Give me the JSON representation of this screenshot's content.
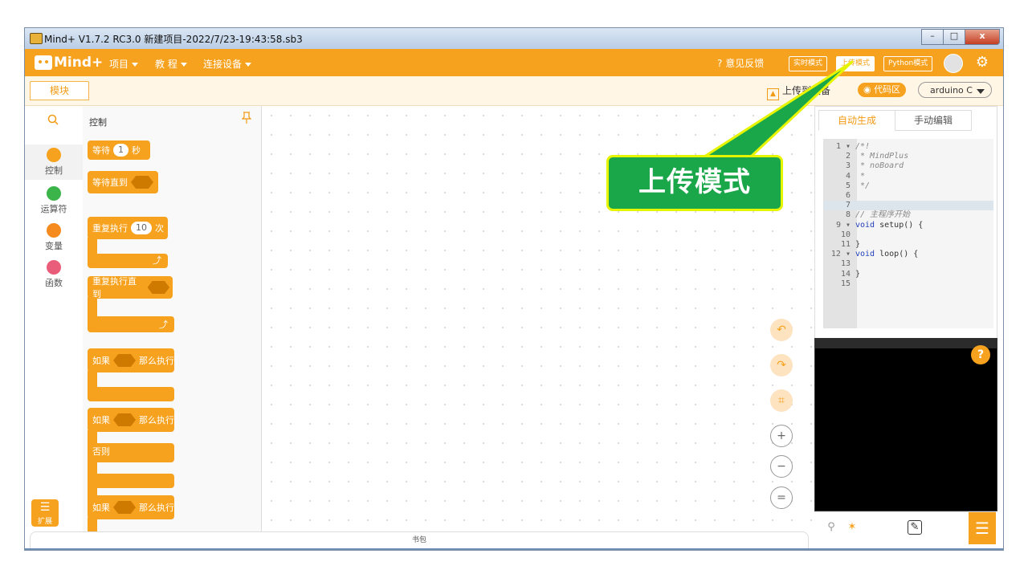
{
  "window": {
    "title": "Mind+ V1.7.2 RC3.0  新建项目-2022/7/23-19:43:58.sb3"
  },
  "menubar": {
    "logo": "Mind+",
    "items": [
      "项目",
      "教 程",
      "连接设备"
    ],
    "feedback": "意见反馈",
    "modes": [
      "实时模式",
      "上传模式",
      "Python模式"
    ],
    "active_mode": "上传模式"
  },
  "toolbar": {
    "blocks_tab": "模块",
    "upload_to_device": "上传到设备",
    "code_area": "代码区",
    "board": "arduino C"
  },
  "categories": [
    {
      "label": "控制",
      "color": "#f7a21e"
    },
    {
      "label": "运算符",
      "color": "#3bb54a"
    },
    {
      "label": "变量",
      "color": "#f58a1f"
    },
    {
      "label": "函数",
      "color": "#ea5d7a"
    }
  ],
  "extensions_label": "扩展",
  "palette": {
    "title": "控制",
    "wait": {
      "label": "等待",
      "value": "1",
      "unit": "秒"
    },
    "wait_until": "等待直到",
    "repeat": {
      "label": "重复执行",
      "value": "10",
      "unit": "次"
    },
    "repeat_until": "重复执行直到",
    "if_then": {
      "if": "如果",
      "then": "那么执行"
    },
    "if_else": {
      "if": "如果",
      "then": "那么执行",
      "else": "否则"
    },
    "if_then2": {
      "if": "如果",
      "then": "那么执行"
    }
  },
  "callout": "上传模式",
  "code_tabs": [
    "自动生成",
    "手动编辑"
  ],
  "code_lines": [
    {
      "n": "1 ▾",
      "t": "/*!",
      "c": "cmt"
    },
    {
      "n": "2",
      "t": " * MindPlus",
      "c": "cmt"
    },
    {
      "n": "3",
      "t": " * noBoard",
      "c": "cmt"
    },
    {
      "n": "4",
      "t": " *",
      "c": "cmt"
    },
    {
      "n": "5",
      "t": " */",
      "c": "cmt"
    },
    {
      "n": "6",
      "t": "",
      "c": ""
    },
    {
      "n": "7",
      "t": "",
      "c": "cur"
    },
    {
      "n": "8",
      "t": "// 主程序开始",
      "c": "cmt"
    },
    {
      "n": "9 ▾",
      "t": "void setup() {",
      "c": "kw"
    },
    {
      "n": "10",
      "t": "",
      "c": ""
    },
    {
      "n": "11",
      "t": "}",
      "c": ""
    },
    {
      "n": "12 ▾",
      "t": "void loop() {",
      "c": "kw"
    },
    {
      "n": "13",
      "t": "",
      "c": ""
    },
    {
      "n": "14",
      "t": "}",
      "c": ""
    },
    {
      "n": "15",
      "t": "",
      "c": ""
    }
  ],
  "bottom_tab": "书包",
  "help": "?"
}
